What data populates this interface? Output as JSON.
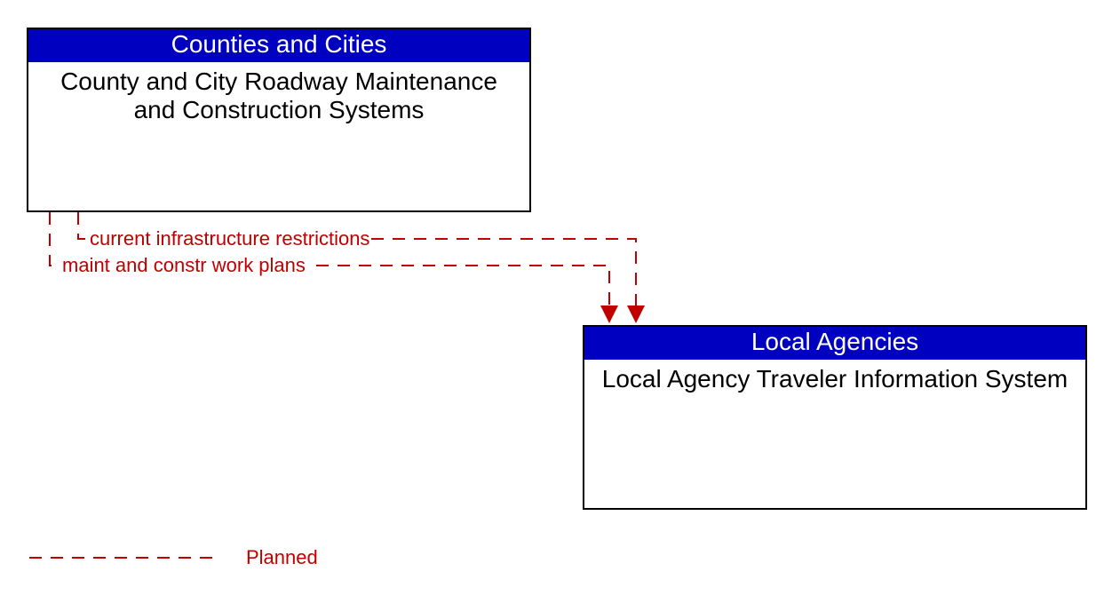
{
  "nodes": {
    "source": {
      "header": "Counties and Cities",
      "body": "County and City Roadway Maintenance and Construction Systems"
    },
    "target": {
      "header": "Local Agencies",
      "body": "Local Agency Traveler Information System"
    }
  },
  "flows": {
    "f1": "current infrastructure restrictions",
    "f2": "maint and constr work plans"
  },
  "legend": {
    "planned": "Planned"
  },
  "colors": {
    "header_bg": "#0000c0",
    "flow": "#c00000"
  }
}
